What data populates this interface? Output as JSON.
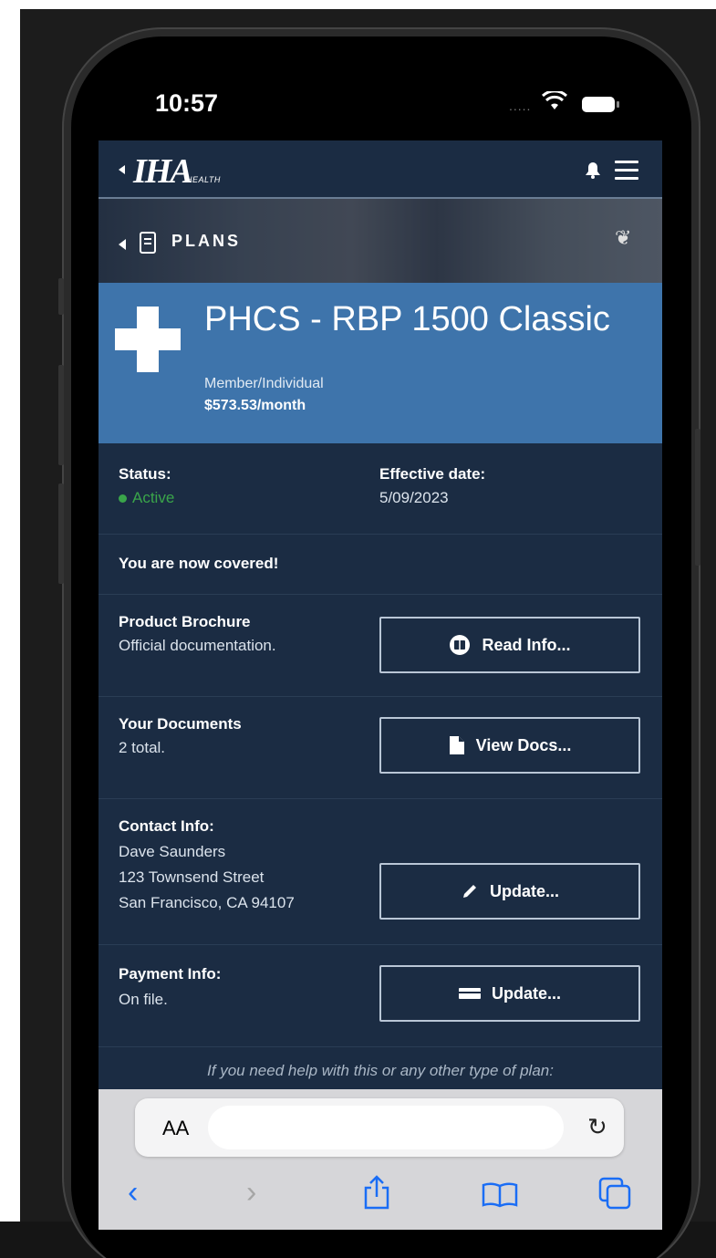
{
  "status_bar": {
    "time": "10:57",
    "signal": "....."
  },
  "app": {
    "logo": "IHA",
    "logo_sub": "HEALTH"
  },
  "hero": {
    "title": "PLANS"
  },
  "plan": {
    "name": "PHCS - RBP 1500 Classic",
    "type": "Member/Individual",
    "price": "$573.53/month"
  },
  "status": {
    "label": "Status:",
    "value": "Active",
    "effective_label": "Effective date:",
    "effective_value": "5/09/2023"
  },
  "coverage_message": "You are now covered!",
  "brochure": {
    "label": "Product Brochure",
    "desc": "Official documentation.",
    "button": "Read Info..."
  },
  "documents": {
    "label": "Your Documents",
    "desc": "2 total.",
    "button": "View Docs..."
  },
  "contact": {
    "label": "Contact Info:",
    "name": "Dave Saunders",
    "street": "123 Townsend Street",
    "city": "San Francisco, CA 94107",
    "button": "Update..."
  },
  "payment": {
    "label": "Payment Info:",
    "desc": "On file.",
    "button": "Update..."
  },
  "help_text": "If you need help with this or any other type of plan:",
  "browser": {
    "aa_label": "AA"
  },
  "colors": {
    "background": "#1b2c43",
    "banner": "#3e74ab",
    "active": "#3aa54a",
    "accent": "#1a6df5"
  }
}
